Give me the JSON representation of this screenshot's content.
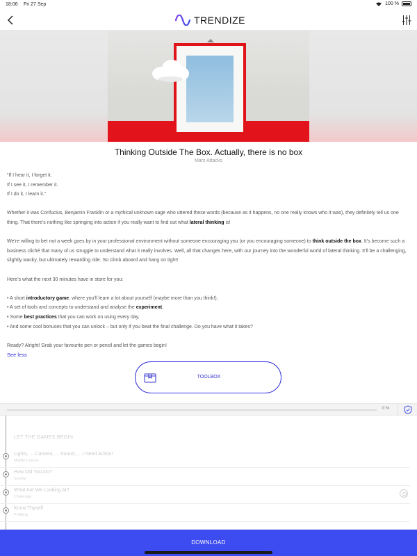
{
  "status_bar": {
    "time": "18:06",
    "date": "Fri 27 Sep",
    "battery": "100 %"
  },
  "nav": {
    "logo_text": "TRENDIZE"
  },
  "article": {
    "title": "Thinking Outside The Box. Actually, there is no box",
    "subtitle": "Mars Attacks",
    "quote": [
      "“If I hear it, I forget it.",
      "If I see it, I remember it.",
      "If I do it, I learn it.”"
    ],
    "p1_a": "Whether it was Confucius, Benjamin Franklin or a mythical unknown sage who uttered these words (because as it happens, no one really knows who it was), they definitely tell us one thing. That there’s nothing like springing into action if you really want to find out what ",
    "p1_b": "lateral thinking",
    "p1_c": " is!",
    "p2_a": "We’re willing to bet not a week goes by in your professional environment without someone encouraging you (or you encouraging someone) to ",
    "p2_b": "think outside the box",
    "p2_c": ". It’s become such a business cliché that many of us struggle to understand what it really involves. Well, all that changes here, with our journey into the wonderful world of lateral thinking. It’ll be a challenging, slightly wacky, but ultimately rewarding ride. So climb aboard and hang on tight!",
    "p3": "Here’s what the next 30 minutes have in store for you:",
    "bullets": [
      {
        "a": "• A short ",
        "b": "introductory game",
        "c": ", where you’ll learn a lot about yourself (maybe more than you think!),"
      },
      {
        "a": "• A set of tools and concepts to understand and analyse the ",
        "b": "experiment",
        "c": ","
      },
      {
        "a": "• Some ",
        "b": "best practices",
        "c": " that you can work on using every day,"
      },
      {
        "a": "• And some cool bonuses that you can unlock – but only if you beat the final challenge. Do you have what it takes?",
        "b": "",
        "c": ""
      }
    ],
    "p4": "Ready? Alright! Grab your favourite pen or pencil and let the games begin!",
    "see_less": "See less"
  },
  "toolbox": {
    "label": "TOOLBOX"
  },
  "progress": {
    "label": "0 %",
    "value": 0
  },
  "timeline": {
    "heading": "LET THE GAMES BEGIN",
    "items": [
      {
        "title": "Lights, ... Camera, ... Sound, ... I Need Action!",
        "type": "Mobile Course"
      },
      {
        "title": "How Did You Do?",
        "type": "Survey"
      },
      {
        "title": "What Are We Looking At?",
        "type": "Challenge"
      },
      {
        "title": "Know Thyself",
        "type": "Profiling"
      }
    ]
  },
  "download": {
    "label": "DOWNLOAD"
  },
  "colors": {
    "accent": "#3d4cf0",
    "hero_red": "#e2131b"
  }
}
